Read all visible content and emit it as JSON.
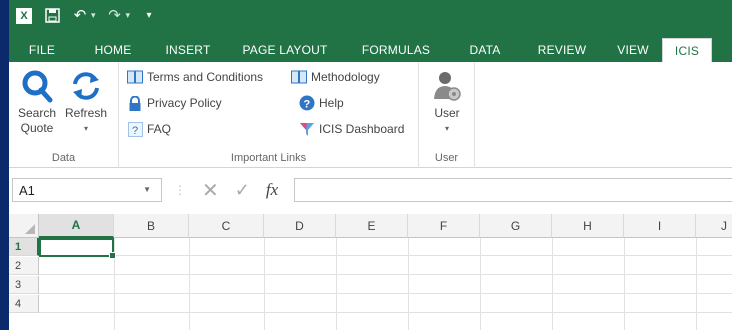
{
  "app": {
    "logo": "X"
  },
  "qat": {
    "save": "save-icon",
    "undo": "undo-icon",
    "redo": "redo-icon",
    "customize": "customize-icon"
  },
  "tabs": [
    {
      "label": "FILE"
    },
    {
      "label": "HOME"
    },
    {
      "label": "INSERT"
    },
    {
      "label": "PAGE LAYOUT"
    },
    {
      "label": "FORMULAS"
    },
    {
      "label": "DATA"
    },
    {
      "label": "REVIEW"
    },
    {
      "label": "VIEW"
    },
    {
      "label": "ICIS"
    }
  ],
  "ribbon": {
    "data_group": {
      "label": "Data",
      "search_quote": "Search\nQuote",
      "search_line1": "Search",
      "search_line2": "Quote",
      "refresh": "Refresh"
    },
    "links_group": {
      "label": "Important Links",
      "terms": "Terms and Conditions",
      "privacy": "Privacy Policy",
      "faq": "FAQ",
      "methodology": "Methodology",
      "help": "Help",
      "dashboard": "ICIS Dashboard"
    },
    "user_group": {
      "label": "User",
      "user": "User"
    }
  },
  "formula_bar": {
    "name_box": "A1",
    "fx": "fx",
    "value": ""
  },
  "grid": {
    "columns": [
      "A",
      "B",
      "C",
      "D",
      "E",
      "F",
      "G",
      "H",
      "I",
      "J"
    ],
    "rows": [
      "1",
      "2",
      "3",
      "4"
    ],
    "active_cell": "A1"
  },
  "colors": {
    "accent": "#217346",
    "background": "#0a2a6b"
  }
}
